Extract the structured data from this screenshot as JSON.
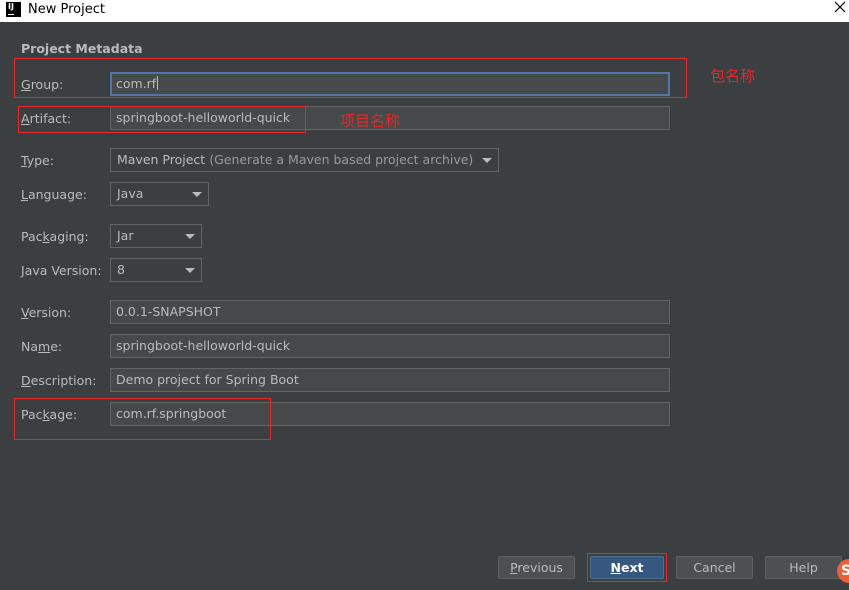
{
  "window": {
    "title": "New Project",
    "icon_text": "IJ"
  },
  "section_title": "Project Metadata",
  "fields": {
    "group": {
      "label_mnemonic": "G",
      "label_rest": "roup:",
      "value": "com.rf"
    },
    "artifact": {
      "label_mnemonic": "A",
      "label_rest": "rtifact:",
      "value": "springboot-helloworld-quick"
    },
    "type": {
      "label_mnemonic": "T",
      "label_rest": "ype:",
      "value": "Maven Project",
      "hint": "(Generate a Maven based project archive)"
    },
    "language": {
      "label_mnemonic": "L",
      "label_rest": "anguage:",
      "value": "Java"
    },
    "packaging": {
      "label_pre": "Pac",
      "label_mnemonic": "k",
      "label_rest": "aging:",
      "value": "Jar"
    },
    "java_version": {
      "label_mnemonic": "J",
      "label_rest": "ava Version:",
      "value": "8"
    },
    "version": {
      "label_mnemonic": "V",
      "label_rest": "ersion:",
      "value": "0.0.1-SNAPSHOT"
    },
    "name": {
      "label_pre": "Na",
      "label_mnemonic": "m",
      "label_rest": "e:",
      "value": "springboot-helloworld-quick"
    },
    "description": {
      "label_mnemonic": "D",
      "label_rest": "escription:",
      "value": "Demo project for Spring Boot"
    },
    "package": {
      "label_pre": "Pac",
      "label_mnemonic": "k",
      "label_rest": "age:",
      "value": "com.rf.springboot"
    }
  },
  "annotations": {
    "group_note": "包名称",
    "artifact_note": "项目名称"
  },
  "buttons": {
    "previous": {
      "mnemonic": "P",
      "rest": "revious"
    },
    "next": {
      "mnemonic": "N",
      "rest": "ext"
    },
    "cancel": "Cancel",
    "help": "Help"
  },
  "corner_logo": "S",
  "colors": {
    "background": "#3c3f41",
    "field_bg": "#45494a",
    "annotation_red": "#e4282b",
    "primary_button": "#365880",
    "focus_border": "#4f76a5"
  },
  "icons": [
    "close-icon",
    "dropdown-arrow-icon",
    "intellij-logo-icon"
  ]
}
